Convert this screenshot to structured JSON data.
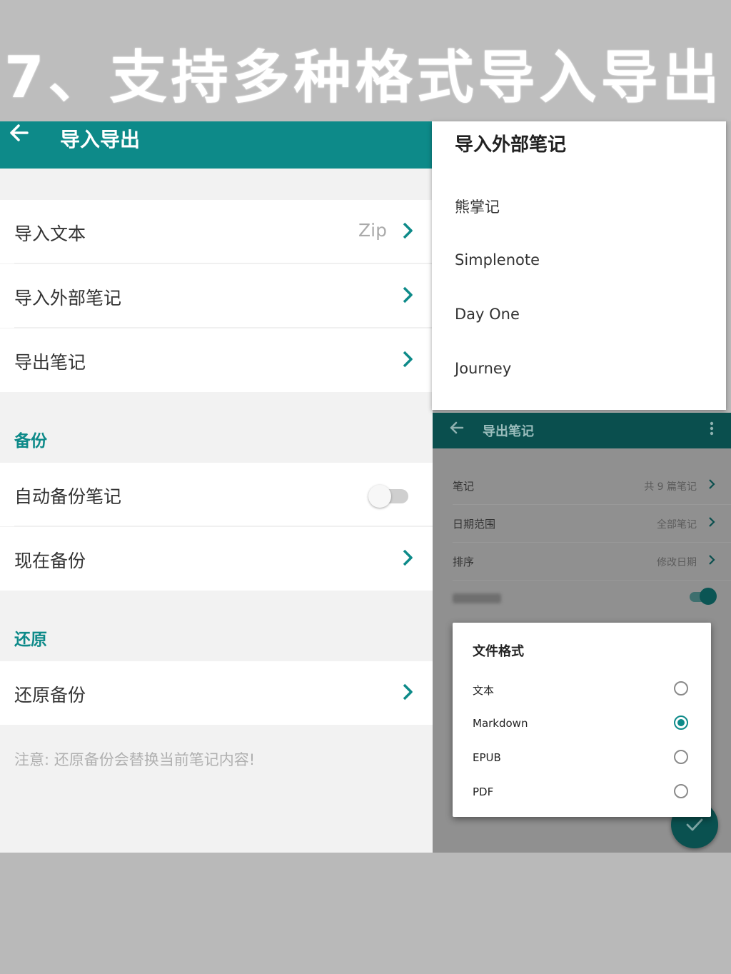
{
  "banner": {
    "title": "7、支持多种格式导入导出"
  },
  "left": {
    "appbar_title": "导入导出",
    "rows": {
      "import_text": {
        "label": "导入文本",
        "value": "Zip"
      },
      "import_external": {
        "label": "导入外部笔记"
      },
      "export_notes": {
        "label": "导出笔记"
      },
      "auto_backup": {
        "label": "自动备份笔记",
        "enabled": false
      },
      "backup_now": {
        "label": "现在备份"
      },
      "restore_backup": {
        "label": "还原备份"
      }
    },
    "sections": {
      "backup": "备份",
      "restore": "还原"
    },
    "note": "注意: 还原备份会替换当前笔记内容!"
  },
  "import_dialog": {
    "title": "导入外部笔记",
    "options": [
      "熊掌记",
      "Simplenote",
      "Day One",
      "Journey"
    ]
  },
  "export_screen": {
    "title": "导出笔记",
    "rows": [
      {
        "label": "笔记",
        "value": "共 9 篇笔记"
      },
      {
        "label": "日期范围",
        "value": "全部笔记"
      },
      {
        "label": "排序",
        "value": "修改日期"
      }
    ],
    "toggle_on": true
  },
  "format_dialog": {
    "title": "文件格式",
    "options": [
      "文本",
      "Markdown",
      "EPUB",
      "PDF"
    ],
    "selected": "Markdown"
  },
  "colors": {
    "accent": "#0d8a89",
    "dim_bar": "#0a4f4e"
  }
}
